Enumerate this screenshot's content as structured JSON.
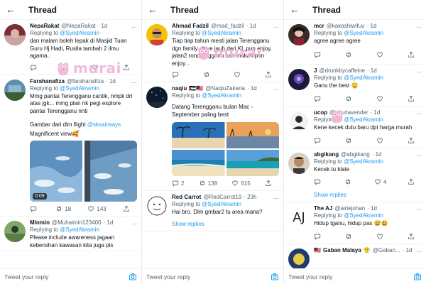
{
  "header": {
    "title": "Thread"
  },
  "reply_bar": {
    "placeholder": "Tweet your reply"
  },
  "watermark": {
    "text": "murai"
  },
  "colors": {
    "link": "#1d9bf0",
    "muted": "#536471",
    "watermark": "#f3b4d6"
  },
  "panel1": {
    "tweets": [
      {
        "name": "NepaRakat",
        "handle": "@NepaRakat",
        "time": "· 1d",
        "replying": "Replying to",
        "replying_to": "@SyedAkramin",
        "text": "dan malam boleh lepak di Masjid Tuan Guru Hj Hadi, Rusila tambah 2 ilmu agama..",
        "stats": {
          "replies": "",
          "retweets": "",
          "likes": ""
        }
      },
      {
        "name": "Farahanafiza",
        "handle": "@farahanafiza",
        "time": "· 1d",
        "replying": "Replying to",
        "replying_to": "@SyedAkramin",
        "text": "Mmg pantai Terengganu cantik, nmpk dri atas jgk... mmg plan nk pegi explore pantai Terengganu nnti",
        "text2": "Gambar dari dlm flight ",
        "text2_link": "@sksairways",
        "text3": "Magnificent view🥰",
        "video_time": "0:09",
        "stats": {
          "replies": "",
          "retweets": "18",
          "likes": "143"
        }
      },
      {
        "name": "Minmin",
        "handle": "@Muhaimin123400",
        "time": "· 1d",
        "replying": "Replying to",
        "replying_to": "@SyedAkramin",
        "text": "Please include awareness jagaan kebersihan kawasan kita juga pls"
      }
    ]
  },
  "panel2": {
    "tweets": [
      {
        "name": "Ahmad Fadzil",
        "handle": "@mad_fadzil",
        "time": "· 1d",
        "replying": "Replying to",
        "replying_to": "@SyedAkramin",
        "text": "Tiap tiap tahun mesti jalan Terengganu dgn family..drive jauh dari KL pun enjoy, jalan2 ronda Tgganu cari makan pun enjoy...",
        "stats": {
          "replies": "",
          "retweets": "",
          "likes": ""
        }
      },
      {
        "name": "naqiu",
        "handle": "@NaqiuZakaria",
        "time": "· 1d",
        "replying": "Replying to",
        "replying_to": "@SyedAkramin",
        "flag": "🇵🇸🇲🇾",
        "text": "Datang Terengganu bulan Mac - September paling best",
        "stats": {
          "replies": "2",
          "retweets": "138",
          "likes": "615"
        }
      },
      {
        "name": "Red Carrot",
        "handle": "@RedCarrot19",
        "time": "· 23h",
        "replying": "Replying to",
        "replying_to": "@SyedAkramin",
        "text": "Hai bro. Dlm gmbar2 tu area mana?"
      }
    ],
    "show_replies": "Show replies"
  },
  "panel3": {
    "tweets": [
      {
        "name": "mcr",
        "handle": "@kakashiwifuu",
        "time": "· 1d",
        "replying": "Replying to",
        "replying_to": "@SyedAkramin",
        "text": "agree agree agree"
      },
      {
        "name": "J",
        "handle": "@drunkbycaffeine",
        "time": "· 1d",
        "replying": "Replying to",
        "replying_to": "@SyedAkramin",
        "text": "Ganu the best 🤤"
      },
      {
        "name": "ucop",
        "handle": "@yourlavender",
        "time": "· 1d",
        "replying": "Replying to",
        "replying_to": "@SyedAkramin",
        "text": "Kene kecek dulu baru dpt harga murah"
      },
      {
        "name": "abgikang",
        "handle": "@abgikang",
        "time": "· 1d",
        "replying": "Replying to",
        "replying_to": "@SyedAkramin",
        "text": "Kecek tu klate",
        "stats": {
          "replies": "",
          "retweets": "",
          "likes": "4"
        }
      },
      {
        "name": "The AJ",
        "handle": "@airiejohan",
        "time": "· 1d",
        "replying": "Replying to",
        "replying_to": "@SyedAkramin",
        "text": "Hidup tganu, hidup pas 😅😃",
        "avatar_text": "AJ"
      },
      {
        "name": "Gaban Malaya",
        "handle": "@Gaban...",
        "time": "· 1d",
        "flag": "🇲🇾",
        "emoji": "😤"
      }
    ],
    "show_replies": "Show replies"
  }
}
